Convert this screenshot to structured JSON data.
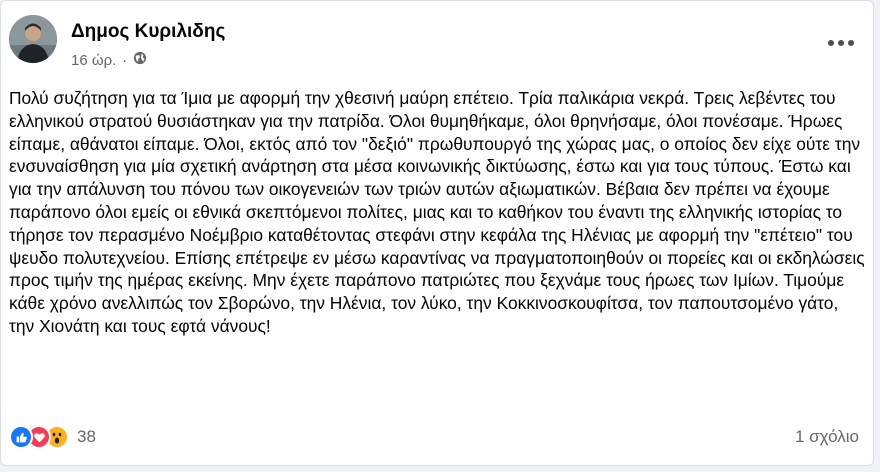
{
  "post": {
    "author": "Δημος Κυριλιδης",
    "time": "16 ώρ.",
    "separator": "·",
    "privacy_icon": "globe-icon",
    "more_icon": "more-options-icon",
    "text": "Πολύ συζήτηση για τα Ίμια με αφορμή την χθεσινή μαύρη επέτειο. Τρία παλικάρια νεκρά. Τρεις λεβέντες του ελληνικού στρατού θυσιάστηκαν για την πατρίδα. Όλοι θυμηθήκαμε, όλοι θρηνήσαμε, όλοι πονέσαμε. Ήρωες είπαμε, αθάνατοι είπαμε. Όλοι, εκτός από τον \"δεξιό\" πρωθυπουργό της χώρας μας, ο οποίος δεν είχε ούτε την ενσυναίσθηση για μία σχετική ανάρτηση στα μέσα κοινωνικής δικτύωσης, έστω και για τους τύπους. Έστω και για την απάλυνση του πόνου των οικογενειών των τριών αυτών αξιωματικών. Βέβαια δεν πρέπει να έχουμε παράπονο όλοι εμείς οι εθνικά σκεπτόμενοι πολίτες, μιας και το καθήκον του έναντι της ελληνικής ιστορίας το τήρησε τον περασμένο Νοέμβριο καταθέτοντας στεφάνι στην κεφάλα της Ηλένιας με αφορμή την \"επέτειο\" του ψευδο πολυτεχνείου. Επίσης επέτρεψε εν μέσω καραντίνας να πραγματοποιηθούν οι πορείες και οι εκδηλώσεις προς τιμήν της ημέρας εκείνης. Μην έχετε παράπονο πατριώτες που ξεχνάμε τους ήρωες των Ιμίων. Τιμούμε κάθε χρόνο ανελλιπώς τον Σβορώνο, την Ηλένια, τον λύκο, την Κοκκινοσκουφίτσα, τον παπουτσομένο γάτο, την Χιονάτη και τους εφτά νάνους!"
  },
  "reactions": {
    "icons": [
      "like-icon",
      "love-icon",
      "wow-icon"
    ],
    "count": "38",
    "comments": "1 σχόλιο"
  },
  "colors": {
    "like": "#1877f2",
    "love": "#f33e58",
    "wow": "#f7b125",
    "secondary_text": "#65676b"
  }
}
